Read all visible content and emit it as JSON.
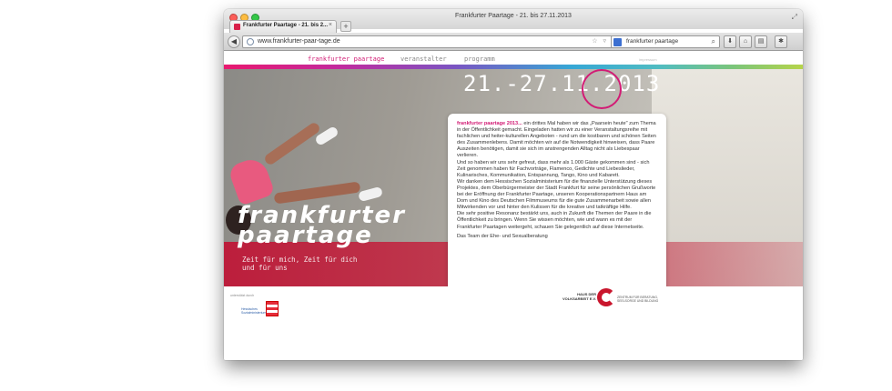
{
  "browser": {
    "window_title": "Frankfurter Paartage - 21. bis 27.11.2013",
    "tab_label": "Frankfurter Paartage - 21. bis 2...",
    "tab_close": "×",
    "new_tab": "+",
    "url": "www.frankfurter-paar-tage.de",
    "search_query": "frankfurter paartage",
    "back_icon": "back-arrow",
    "url_actions": "☆ ▿ C",
    "toolbar_icons": [
      "download-icon",
      "home-icon",
      "bookmarks-icon",
      "addons-icon"
    ]
  },
  "site": {
    "nav": [
      {
        "label": "frankfurter paartage",
        "active": true
      },
      {
        "label": "veranstalter",
        "active": false
      },
      {
        "label": "programm",
        "active": false
      }
    ],
    "impressum": "impressum",
    "date_banner": "21.-27.11.2013",
    "brand_line1": "frankfurter",
    "brand_line2": "paartage",
    "tagline_line1": "Zeit für mich, Zeit für dich",
    "tagline_line2": "und für uns",
    "colors": {
      "accent": "#d21c75",
      "red_band": "#be1838",
      "text": "#333333"
    },
    "article": {
      "lead": "frankfurter paartage 2013...",
      "p1": " ein drittes Mal haben wir das „Paarsein heute\" zum Thema in der Öffentlichkeit gemacht. Eingeladen hatten wir zu einer Veranstaltungsreihe mit fachlichen und heiter-kulturellen Angeboten - rund um die kostbaren und schönen Seiten des Zusammenlebens. Damit möchten wir auf die Notwendigkeit hinweisen, dass Paare Auszeiten benötigen, damit sie sich im anstrengenden Alltag nicht als Liebespaar verlieren.",
      "p2": "Und so haben wir uns sehr gefreut, dass mehr als 1.000 Gäste gekommen sind - sich Zeit genommen haben für Fachvorträge, Flamenco, Gedichte und Liebeslieder, Kulinarisches, Kommunikation, Entspannung, Tango, Kino und Kabarett.",
      "p3": "Wir danken dem Hessischen Sozialministerium für die finanzielle Unterstützung dieses Projektes, dem Oberbürgermeister der Stadt Frankfurt für seine persönlichen Grußworte bei der Eröffnung der Frankfurter Paartage, unseren Kooperationspartnern Haus am Dom und Kino des Deutschen Filmmuseums für die gute Zusammenarbeit sowie allen Mitwirkenden vor und hinter den Kulissen für die kreative und tatkräftige Hilfe.",
      "p4": "Die sehr positive Resonanz bestärkt uns, auch in Zukunft die Themen der Paare in die Öffentlichkeit zu bringen. Wenn Sie wissen möchten, wie und wann es mit der Frankfurter Paartagen weitergeht, schauen Sie gelegentlich auf diese Internetseite.",
      "p5": "Das Team der Ehe- und Sexualberatung"
    },
    "footer": {
      "sponsor_label": "unterstützt durch",
      "hessen_line1": "Hessisches",
      "hessen_line2": "Sozialministerium",
      "hdv_line1": "HAUS DER",
      "hdv_line2": "VOLKSARBEIT E.V.",
      "hdv_sub_line1": "ZENTRUM FÜR BERATUNG,",
      "hdv_sub_line2": "SEELSORGE UND BILDUNG"
    }
  }
}
